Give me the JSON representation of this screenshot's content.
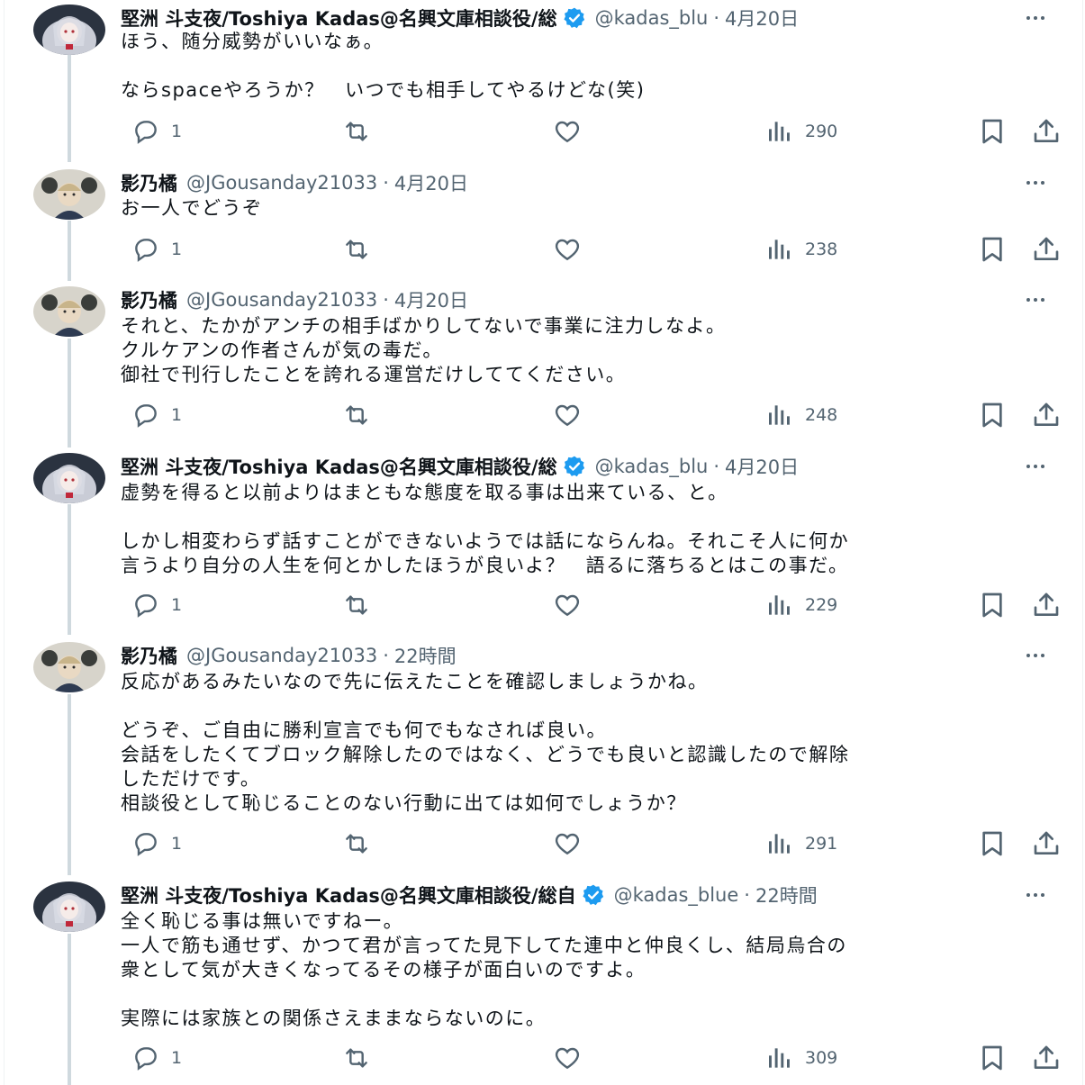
{
  "icons": {
    "reply": "reply-icon",
    "retweet": "retweet-icon",
    "like": "like-icon",
    "views": "views-icon",
    "bookmark": "bookmark-icon",
    "share": "share-icon",
    "more": "more-icon",
    "verified": "verified-badge-icon"
  },
  "colors": {
    "verified": "#1d9bf0",
    "muted": "#536471",
    "thread_line": "#cfd9de"
  },
  "tweets": [
    {
      "name": "堅洲 斗支夜/Toshiya Kadas@名興文庫相談役/総",
      "verified": true,
      "handle": "@kadas_blu",
      "time": "4月20日",
      "lines": [
        "ほう、随分威勢がいいなぁ。",
        "",
        "ならspaceやろうか？　いつでも相手してやるけどな(笑)"
      ],
      "replies": "1",
      "views": "290"
    },
    {
      "name": "影乃橘",
      "verified": false,
      "handle": "@JGousanday21033",
      "time": "4月20日",
      "lines": [
        "お一人でどうぞ"
      ],
      "replies": "1",
      "views": "238"
    },
    {
      "name": "影乃橘",
      "verified": false,
      "handle": "@JGousanday21033",
      "time": "4月20日",
      "lines": [
        "それと、たかがアンチの相手ばかりしてないで事業に注力しなよ。",
        "クルケアンの作者さんが気の毒だ。",
        "御社で刊行したことを誇れる運営だけしててください。"
      ],
      "replies": "1",
      "views": "248"
    },
    {
      "name": "堅洲 斗支夜/Toshiya Kadas@名興文庫相談役/総",
      "verified": true,
      "handle": "@kadas_blu",
      "time": "4月20日",
      "lines": [
        "虚勢を得ると以前よりはまともな態度を取る事は出来ている、と。",
        "",
        "しかし相変わらず話すことができないようでは話にならんね。それこそ人に何か",
        "言うより自分の人生を何とかしたほうが良いよ？　語るに落ちるとはこの事だ。"
      ],
      "replies": "1",
      "views": "229"
    },
    {
      "name": "影乃橘",
      "verified": false,
      "handle": "@JGousanday21033",
      "time": "22時間",
      "lines": [
        "反応があるみたいなので先に伝えたことを確認しましょうかね。",
        "",
        "どうぞ、ご自由に勝利宣言でも何でもなされば良い。",
        "会話をしたくてブロック解除したのではなく、どうでも良いと認識したので解除",
        "しただけです。",
        "相談役として恥じることのない行動に出ては如何でしょうか？"
      ],
      "replies": "1",
      "views": "291"
    },
    {
      "name": "堅洲 斗支夜/Toshiya Kadas@名興文庫相談役/総自",
      "verified": true,
      "handle": "@kadas_blue",
      "time": "22時間",
      "lines": [
        "全く恥じる事は無いですねー。",
        "一人で筋も通せず、かつて君が言ってた見下してた連中と仲良くし、結局烏合の",
        "衆として気が大きくなってるその様子が面白いのですよ。",
        "",
        "実際には家族との関係さえままならないのに。"
      ],
      "replies": "1",
      "views": "309"
    }
  ]
}
